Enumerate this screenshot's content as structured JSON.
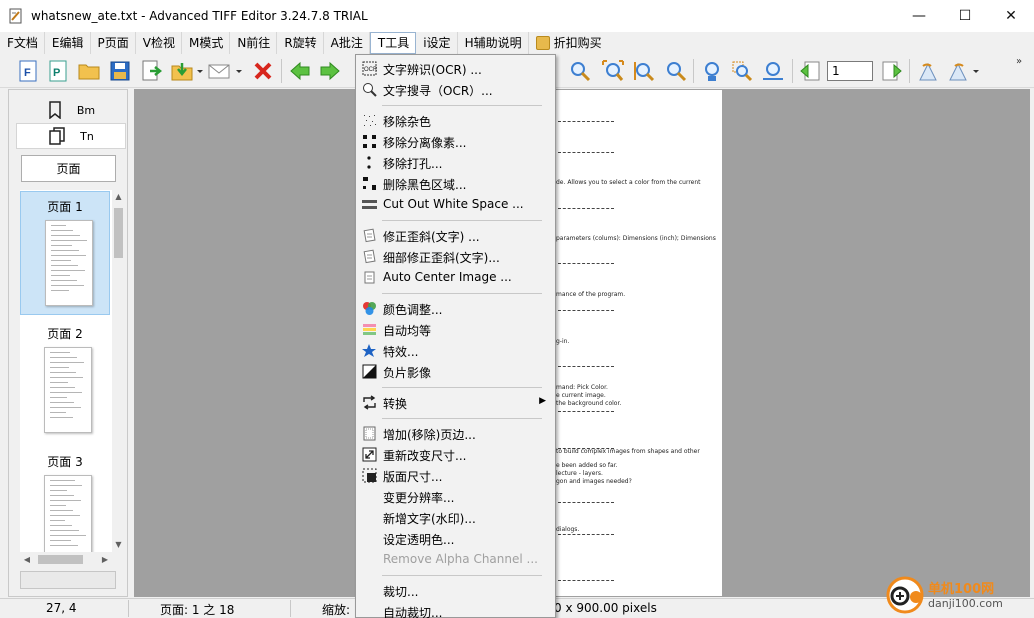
{
  "window": {
    "title": "whatsnew_ate.txt - Advanced TIFF Editor 3.24.7.8 TRIAL",
    "minimize": "—",
    "maximize": "☐",
    "close": "✕"
  },
  "menubar": {
    "items": [
      "F文档",
      "E编辑",
      "P页面",
      "V检视",
      "M模式",
      "N前往",
      "R旋转",
      "A批注",
      "T工具",
      "i设定",
      "H辅助说明"
    ],
    "active_index": 8,
    "promo": "折扣购买"
  },
  "toolbar": {
    "page_input": "1"
  },
  "left_panel": {
    "tab_bm": "Bm",
    "tab_tn": "Tn",
    "pages_button": "页面",
    "thumbnails": [
      "页面 1",
      "页面 2",
      "页面 3"
    ],
    "selected_thumbnail": 0
  },
  "document_lines": [
    "de. Allows you to select a color from the current",
    "parameters (colums): Dimensions (inch); Dimensions",
    "mance of the program.",
    "g-in.",
    "mand: Pick Color.",
    "e current image.",
    "the background color.",
    "to build complex images from shapes and other",
    "e been added so far.",
    "lecture - layers.",
    "gon and images needed?",
    "dialogs."
  ],
  "dropdown": {
    "groups": [
      [
        {
          "label": "文字辨识(OCR) ...",
          "icon": "ocr-icon"
        },
        {
          "label": "文字搜寻（OCR）...",
          "icon": "ocr-search-icon"
        }
      ],
      [
        {
          "label": "移除杂色",
          "icon": "despeckle-icon"
        },
        {
          "label": "移除分离像素...",
          "icon": "remove-pixels-icon"
        },
        {
          "label": "移除打孔...",
          "icon": "punch-holes-icon"
        },
        {
          "label": "删除黑色区域...",
          "icon": "black-border-icon"
        },
        {
          "label": "Cut Out White Space ...",
          "icon": "cut-whitespace-icon"
        }
      ],
      [
        {
          "label": "修正歪斜(文字) ...",
          "icon": "deskew-icon"
        },
        {
          "label": "细部修正歪斜(文字)...",
          "icon": "fine-deskew-icon"
        },
        {
          "label": "Auto Center Image ...",
          "icon": "center-image-icon"
        }
      ],
      [
        {
          "label": "颜色调整...",
          "icon": "color-adjust-icon"
        },
        {
          "label": "自动均等",
          "icon": "auto-equalize-icon"
        },
        {
          "label": "特效...",
          "icon": "effects-icon"
        },
        {
          "label": "负片影像",
          "icon": "negative-icon"
        }
      ],
      [
        {
          "label": "转换",
          "icon": "convert-icon",
          "submenu": true
        }
      ],
      [
        {
          "label": "增加(移除)页边...",
          "icon": "margins-icon"
        },
        {
          "label": "重新改变尺寸...",
          "icon": "resize-icon"
        },
        {
          "label": "版面尺寸...",
          "icon": "canvas-size-icon"
        },
        {
          "label": "变更分辨率...",
          "icon": ""
        },
        {
          "label": "新增文字(水印)...",
          "icon": ""
        },
        {
          "label": "设定透明色...",
          "icon": ""
        },
        {
          "label": "Remove Alpha Channel ...",
          "icon": "",
          "disabled": true
        }
      ],
      [
        {
          "label": "裁切...",
          "icon": ""
        },
        {
          "label": "自动裁切...",
          "icon": ""
        }
      ]
    ],
    "submenu_arrow": "▶"
  },
  "statusbar": {
    "coords": "27, 4",
    "page": "页面: 1 之 18",
    "zoom_label": "缩放:",
    "dimensions": "0 x 900.00 pixels"
  },
  "watermark": {
    "text1": "单机100网",
    "text2": "danji100.com"
  },
  "colors": {
    "menu_bg": "#f2f2f2",
    "workarea": "#a0a0a0",
    "selection": "#cce4f7",
    "accent": "#0078d7"
  }
}
